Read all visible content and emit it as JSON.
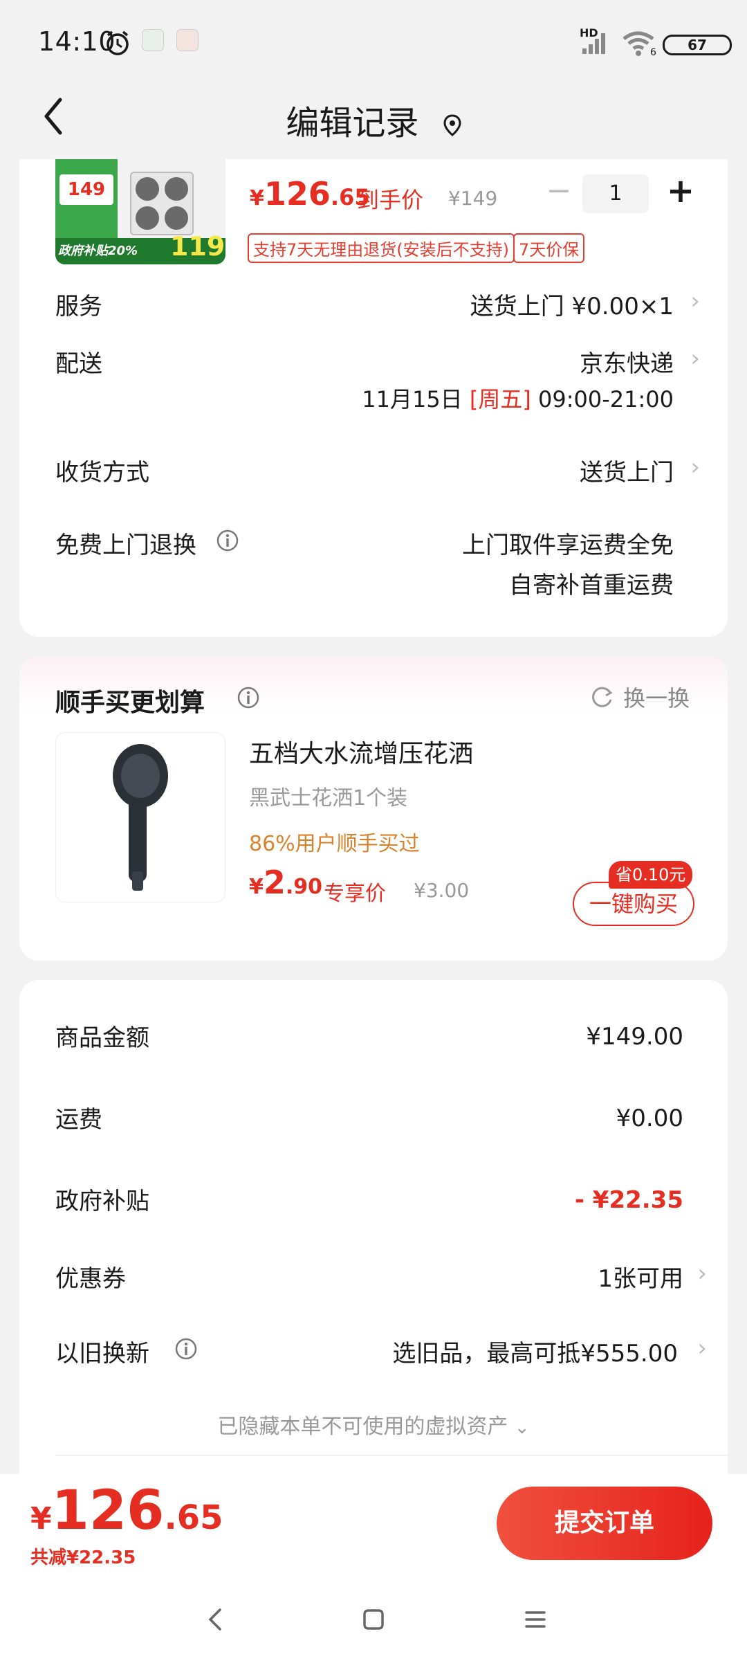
{
  "status": {
    "time": "14:10",
    "battery": "67",
    "network": "HD"
  },
  "header": {
    "title": "编辑记录"
  },
  "product": {
    "price_int": "126",
    "price_dec": ".65",
    "price_currency": "¥",
    "price_note": "到手价",
    "orig_price": "¥149",
    "quantity": "1",
    "tags": [
      "支持7天无理由退货(安装后不支持)",
      "7天价保"
    ],
    "thumb_price": "149",
    "thumb_badge": "119",
    "thumb_subsidy": "政府补贴20%"
  },
  "service": {
    "label": "服务",
    "value": "送货上门 ¥0.00×1"
  },
  "delivery": {
    "label": "配送",
    "carrier": "京东快递",
    "date": "11月15日",
    "weekday": "[周五]",
    "time": "09:00-21:00"
  },
  "receive": {
    "label": "收货方式",
    "value": "送货上门"
  },
  "free_return": {
    "label": "免费上门退换",
    "line1": "上门取件享运费全免",
    "line2": "自寄补首重运费"
  },
  "addon": {
    "title": "顺手买更划算",
    "refresh": "换一换",
    "name": "五档大水流增压花洒",
    "spec": "黑武士花洒1个装",
    "social": "86%用户顺手买过",
    "price_int": "2",
    "price_dec": ".90",
    "price_note": "专享价",
    "orig_price": "¥3.00",
    "save_badge": "省0.10元",
    "buy_button": "一键购买"
  },
  "summary": {
    "goods_label": "商品金额",
    "goods_value": "¥149.00",
    "freight_label": "运费",
    "freight_value": "¥0.00",
    "subsidy_label": "政府补贴",
    "subsidy_value": "- ¥22.35",
    "coupon_label": "优惠券",
    "coupon_value": "1张可用",
    "tradein_label": "以旧换新",
    "tradein_value": "选旧品，最高可抵¥555.00",
    "hidden_note": "已隐藏本单不可使用的虚拟资产"
  },
  "footer": {
    "currency": "¥",
    "total_int": "126",
    "total_dec": ".65",
    "saved": "共减¥22.35",
    "submit": "提交订单"
  },
  "colors": {
    "accent": "#e62d21",
    "orange": "#d9822b"
  }
}
